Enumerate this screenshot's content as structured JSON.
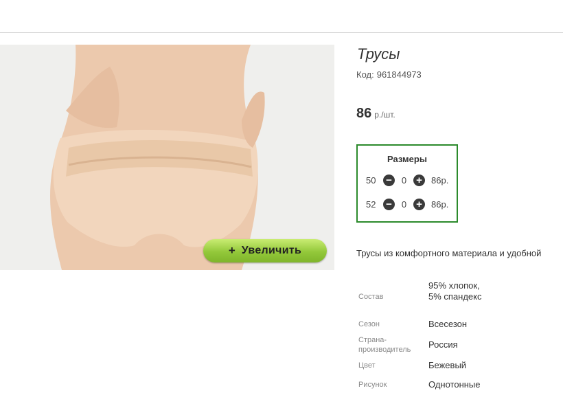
{
  "product": {
    "title": "Трусы",
    "code_label": "Код:",
    "code_value": "961844973",
    "price_value": "86",
    "price_unit": "р./шт."
  },
  "zoom_button": {
    "plus": "+",
    "label": "Увеличить"
  },
  "sizes": {
    "title": "Размеры",
    "rows": [
      {
        "size": "50",
        "minus": "−",
        "qty": "0",
        "plus": "+",
        "price": "86р."
      },
      {
        "size": "52",
        "minus": "−",
        "qty": "0",
        "plus": "+",
        "price": "86р."
      }
    ]
  },
  "description": "Трусы из комфортного материала и удобной",
  "specs": [
    {
      "label": "Состав",
      "value": "95% хлопок, 5% спандекс"
    },
    {
      "label": "Сезон",
      "value": "Всесезон"
    },
    {
      "label": "Страна-производитель",
      "value": "Россия"
    },
    {
      "label": "Цвет",
      "value": "Бежевый"
    },
    {
      "label": "Рисунок",
      "value": "Однотонные"
    }
  ],
  "colors": {
    "frame": "#2b8a2b",
    "zoom_button": "#93c83a",
    "fabric": "#f2d6bd"
  }
}
